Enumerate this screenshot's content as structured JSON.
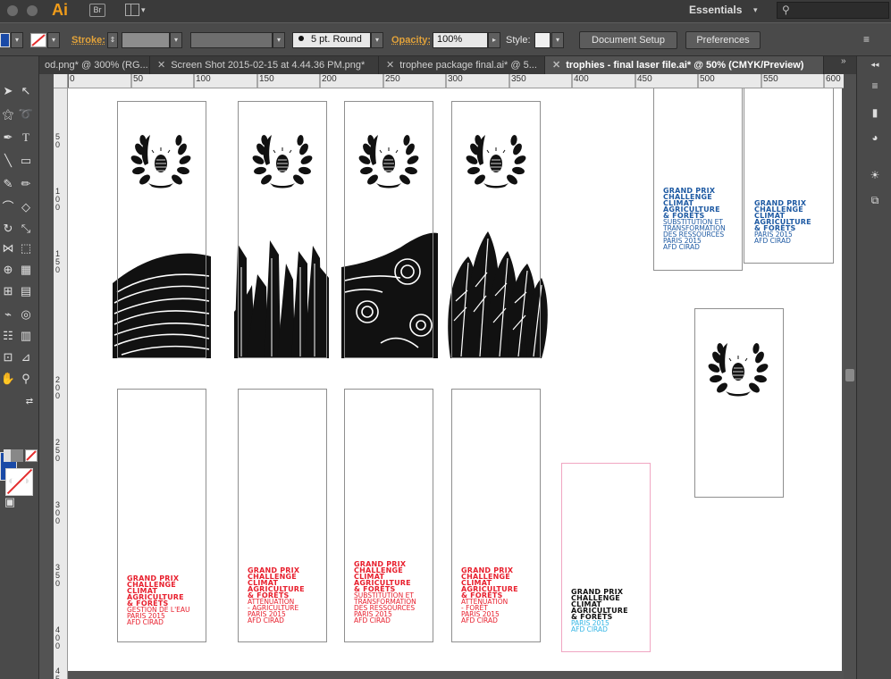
{
  "app": {
    "logo": "Ai",
    "bridge_label": "Br",
    "workspace": "Essentials",
    "search_glyph": "⚲"
  },
  "control_bar": {
    "stroke_label": "Stroke:",
    "brush_value": "5 pt. Round",
    "opacity_label": "Opacity:",
    "opacity_value": "100%",
    "style_label": "Style:",
    "document_setup_label": "Document Setup",
    "preferences_label": "Preferences"
  },
  "tabs": [
    {
      "label": "od.png* @ 300% (RG...",
      "active": false
    },
    {
      "label": "Screen Shot 2015-02-15 at 4.44.36 PM.png*",
      "active": false
    },
    {
      "label": "trophee package final.ai* @ 5...",
      "active": false
    },
    {
      "label": "trophies - final laser file.ai* @ 50% (CMYK/Preview)",
      "active": true
    }
  ],
  "rulers": {
    "horizontal": [
      "0",
      "50",
      "100",
      "150",
      "200",
      "250",
      "300",
      "350",
      "400",
      "450",
      "500",
      "550",
      "600"
    ],
    "vertical": [
      "50",
      "100",
      "150",
      "200",
      "250",
      "300",
      "350",
      "400",
      "450"
    ]
  },
  "colors": {
    "fill": "#1a4aa7",
    "accent_red": "#e8202e",
    "accent_blue": "#1e5aa3",
    "accent_cyan": "#35b6e5",
    "ai_orange": "#f09c1a"
  },
  "artwork": {
    "title_lines": [
      "GRAND PRIX",
      "CHALLENGE",
      "CLIMAT",
      "AGRICULTURE",
      "& FORÊTS"
    ],
    "red_cards": [
      {
        "sub_lines": [
          "GESTION DE L'EAU",
          "PARIS 2015",
          "AFD CIRAD"
        ]
      },
      {
        "sub_lines": [
          "ATTÉNUATION",
          "- AGRICULTURE",
          "PARIS 2015",
          "AFD CIRAD"
        ]
      },
      {
        "sub_lines": [
          "SUBSTITUTION ET",
          "TRANSFORMATION",
          "DES RESSOURCES",
          "PARIS 2015",
          "AFD CIRAD"
        ]
      },
      {
        "sub_lines": [
          "ATTÉNUATION",
          "- FORÊT",
          "PARIS 2015",
          "AFD CIRAD"
        ]
      }
    ],
    "blue_cards": [
      {
        "sub_lines": [
          "SUBSTITUTION ET",
          "TRANSFORMATION",
          "DES RESSOURCES",
          "PARIS 2015",
          "AFD CIRAD"
        ]
      },
      {
        "sub_lines": [
          "PARIS 2015",
          "AFD CIRAD"
        ]
      }
    ],
    "black_card": {
      "sub_lines": [
        "PARIS 2015",
        "AFD CIRAD"
      ]
    }
  }
}
